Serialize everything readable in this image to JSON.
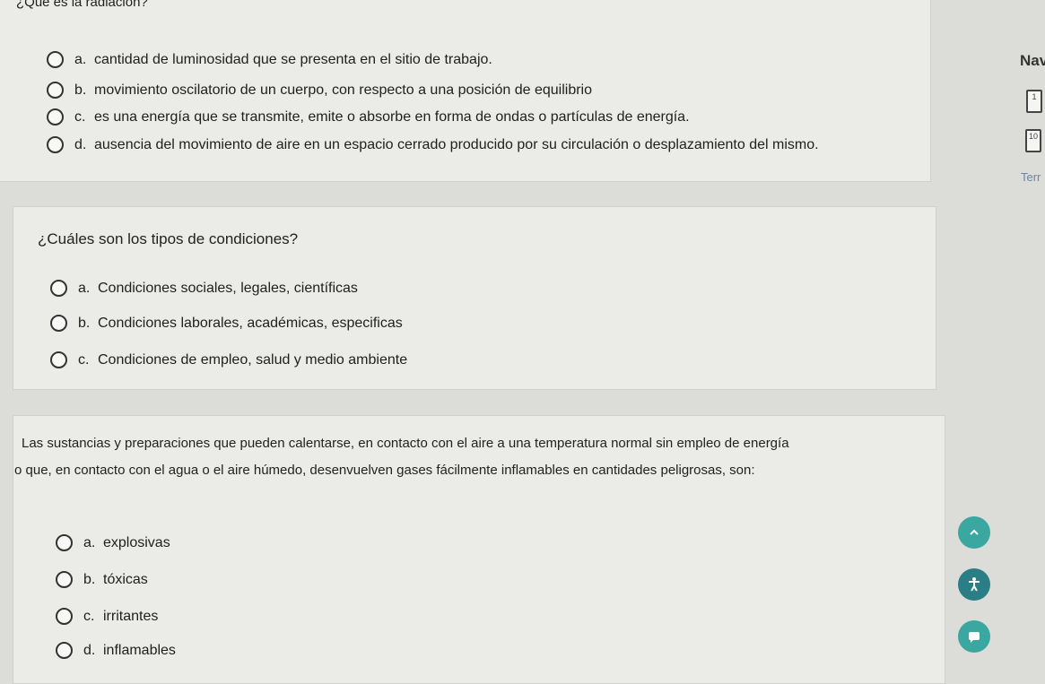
{
  "q1": {
    "title": "¿Qué es la radiación?",
    "options": [
      {
        "letter": "a.",
        "text": "cantidad de luminosidad que se presenta en el sitio de trabajo."
      },
      {
        "letter": "b.",
        "text": "movimiento oscilatorio de un cuerpo, con respecto a una posición de equilibrio"
      },
      {
        "letter": "c.",
        "text": "es una energía que se transmite, emite o absorbe en forma de ondas o partículas de energía."
      },
      {
        "letter": "d.",
        "text": "ausencia del movimiento de aire en un espacio cerrado producido por su circulación o desplazamiento del mismo."
      }
    ]
  },
  "q2": {
    "title": "¿Cuáles son los tipos de condiciones?",
    "options": [
      {
        "letter": "a.",
        "text": "Condiciones sociales, legales, científicas"
      },
      {
        "letter": "b.",
        "text": "Condiciones laborales, académicas, especificas"
      },
      {
        "letter": "c.",
        "text": "Condiciones de empleo, salud y medio ambiente"
      }
    ]
  },
  "q3": {
    "line1": "Las sustancias y preparaciones que pueden calentarse, en contacto con el aire a una temperatura normal sin empleo de energía",
    "line2": "o que, en contacto con el agua o el aire húmedo, desenvuelven gases fácilmente inflamables en cantidades peligrosas, son:",
    "options": [
      {
        "letter": "a.",
        "text": "explosivas"
      },
      {
        "letter": "b.",
        "text": "tóxicas"
      },
      {
        "letter": "c.",
        "text": "irritantes"
      },
      {
        "letter": "d.",
        "text": "inflamables"
      }
    ]
  },
  "nav": {
    "title": "Nav",
    "box1": "1",
    "box2": "10",
    "footer": "Terr"
  },
  "icons": {
    "scroll_up": "chevron-up-icon",
    "accessibility": "accessibility-icon",
    "chat": "chat-icon"
  },
  "colors": {
    "teal": "#3aa7a0",
    "dark_teal": "#2a7f86"
  }
}
